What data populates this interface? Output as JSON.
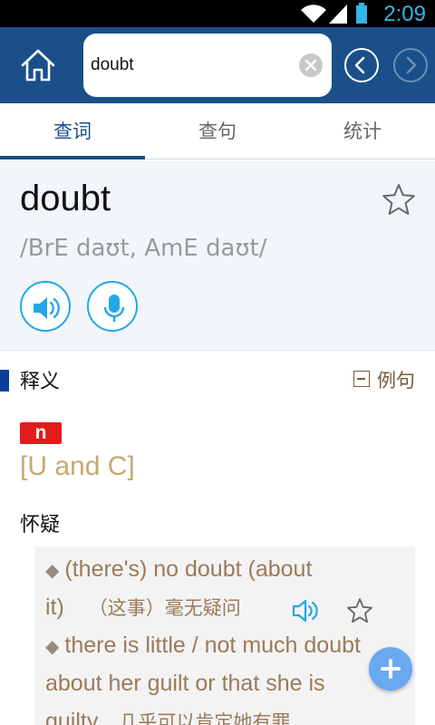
{
  "status_bar": {
    "time": "2:09"
  },
  "search": {
    "value": "doubt"
  },
  "tabs": [
    {
      "label": "查词",
      "active": true
    },
    {
      "label": "查句",
      "active": false
    },
    {
      "label": "统计",
      "active": false
    }
  ],
  "entry": {
    "word": "doubt",
    "phonetic": "/BrE daʊt, AmE daʊt/"
  },
  "section": {
    "title": "释义",
    "examples_toggle": "例句"
  },
  "sense": {
    "pos": "n",
    "grammar": "[U and C]",
    "meaning": "怀疑"
  },
  "examples": [
    {
      "en_line1": "(there's) no doubt (about",
      "en_line2": "it)",
      "cn": "（这事）毫无疑问"
    },
    {
      "en_line1": "there is little / not much doubt",
      "en_line2": "about her guilt or that she is",
      "en_line3": "guilty",
      "cn": "几乎可以肯定她有罪"
    }
  ],
  "colors": {
    "top_bar": "#1a4f8a",
    "accent_blue": "#21a8e6",
    "pos_red": "#e31b1b",
    "grammar_tan": "#c6a96f"
  },
  "icons": [
    "home-icon",
    "clear-icon",
    "back-icon",
    "forward-icon",
    "star-icon",
    "speaker-icon",
    "microphone-icon",
    "collapse-icon",
    "plus-icon"
  ]
}
